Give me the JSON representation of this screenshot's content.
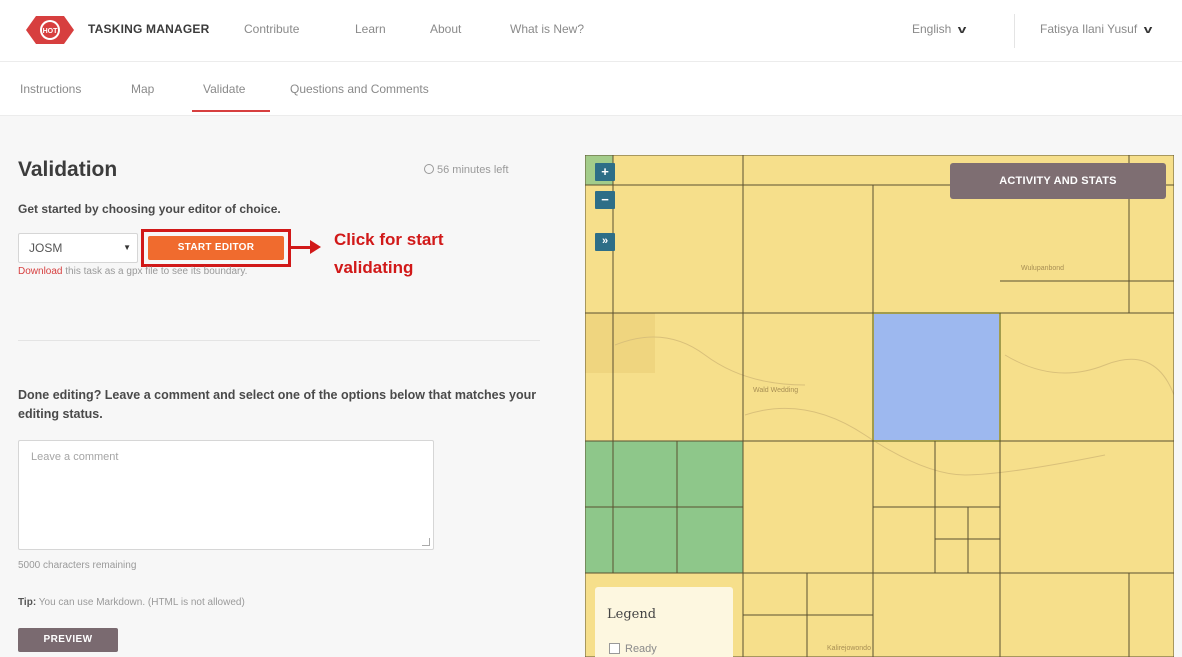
{
  "nav": {
    "brand": "TASKING MANAGER",
    "links": [
      "Contribute",
      "Learn",
      "About",
      "What is New?"
    ],
    "language": "English",
    "user": "Fatisya Ilani Yusuf"
  },
  "tabs": [
    "Instructions",
    "Map",
    "Validate",
    "Questions and Comments"
  ],
  "active_tab": "Validate",
  "validation": {
    "title": "Validation",
    "time_left": "56 minutes left",
    "subtitle": "Get started by choosing your editor of choice.",
    "editor_value": "JOSM",
    "start_button": "START EDITOR",
    "download_link": "Download",
    "download_rest": " this task as a gpx file to see its boundary.",
    "callout": "Click for start validating"
  },
  "done": {
    "prompt": "Done editing? Leave a comment and select one of the options below that matches your editing status.",
    "comment_placeholder": "Leave a comment",
    "remaining": "5000 characters remaining",
    "tip_label": "Tip:",
    "tip_text": " You can use Markdown. (HTML is not allowed)",
    "preview_button": "PREVIEW"
  },
  "map": {
    "activity_button": "ACTIVITY AND STATS",
    "zoom_in": "+",
    "zoom_out": "−",
    "layers_button": "»",
    "legend_title": "Legend",
    "legend_items": [
      "Ready"
    ],
    "colors": {
      "ready": "#f6df8b",
      "selected": "#9db8ef",
      "validated": "#8ec78a",
      "grid": "#5b5030"
    }
  }
}
